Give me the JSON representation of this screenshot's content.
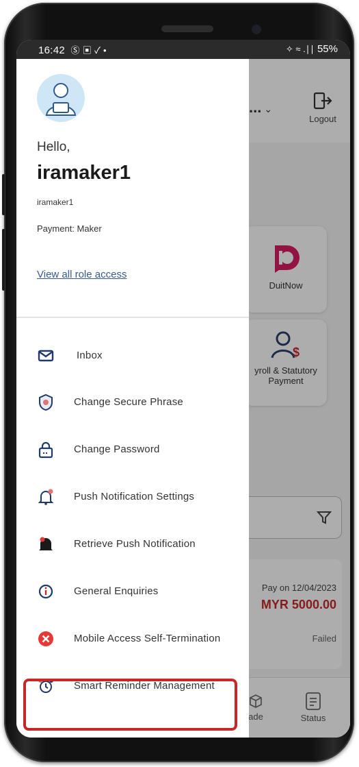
{
  "status_bar": {
    "time": "16:42",
    "left_icons": "Ⓢ ▣ ✓ •",
    "right_icons": "✧ ≈ .∣∣",
    "battery": "55%"
  },
  "background": {
    "user_menu": "...",
    "logout_label": "Logout",
    "cards": [
      {
        "label": "DuitNow"
      },
      {
        "label": "yroll & Statutory Payment"
      }
    ],
    "transaction": {
      "date": "Pay on 12/04/2023",
      "amount": "MYR 5000.00",
      "status": "Failed"
    },
    "bottom_nav": [
      {
        "label": "ade"
      },
      {
        "label": "Status"
      }
    ]
  },
  "drawer": {
    "greeting": "Hello,",
    "username": "iramaker1",
    "user_id": "iramaker1",
    "role": "Payment: Maker",
    "view_roles_link": "View all role access",
    "menu": [
      {
        "label": "Inbox",
        "icon": "mail-icon"
      },
      {
        "label": "Change Secure Phrase",
        "icon": "shield-icon"
      },
      {
        "label": "Change Password",
        "icon": "lock-icon"
      },
      {
        "label": "Push Notification Settings",
        "icon": "bell-settings-icon"
      },
      {
        "label": "Retrieve Push Notification",
        "icon": "bell-retrieve-icon"
      },
      {
        "label": "General Enquiries",
        "icon": "info-icon"
      },
      {
        "label": "Mobile Access Self-Termination",
        "icon": "close-circle-icon"
      },
      {
        "label": "Smart Reminder Management",
        "icon": "alarm-clock-icon"
      }
    ]
  },
  "colors": {
    "accent": "#c62828",
    "link": "#3a5a8c",
    "brand_pink": "#d81b60"
  }
}
